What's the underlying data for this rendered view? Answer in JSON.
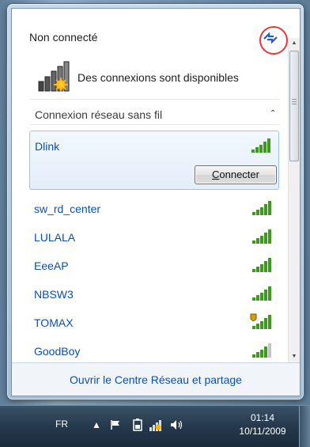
{
  "header": {
    "status": "Non connecté",
    "available_text": "Des connexions sont disponibles",
    "refresh_icon": "refresh-arrows-icon"
  },
  "section": {
    "title": "Connexion réseau sans fil",
    "collapse_glyph": "⌃"
  },
  "networks": [
    {
      "name": "Dlink",
      "signal": 5,
      "secured": false,
      "selected": true
    },
    {
      "name": "sw_rd_center",
      "signal": 5,
      "secured": false
    },
    {
      "name": "LULALA",
      "signal": 5,
      "secured": false
    },
    {
      "name": "EeeAP",
      "signal": 5,
      "secured": false
    },
    {
      "name": "NBSW3",
      "signal": 5,
      "secured": false
    },
    {
      "name": "TOMAX",
      "signal": 5,
      "secured": true
    },
    {
      "name": "GoodBoy",
      "signal": 4,
      "secured": false
    }
  ],
  "connect_button": {
    "underline": "C",
    "rest": "onnecter"
  },
  "footer": {
    "link": "Ouvrir le Centre Réseau et partage"
  },
  "taskbar": {
    "language": "FR",
    "time": "01:14",
    "date": "10/11/2009"
  },
  "colors": {
    "link_blue": "#0d4fa8",
    "signal_green": "#3e9a1f",
    "highlight_red": "#e03a3a"
  }
}
